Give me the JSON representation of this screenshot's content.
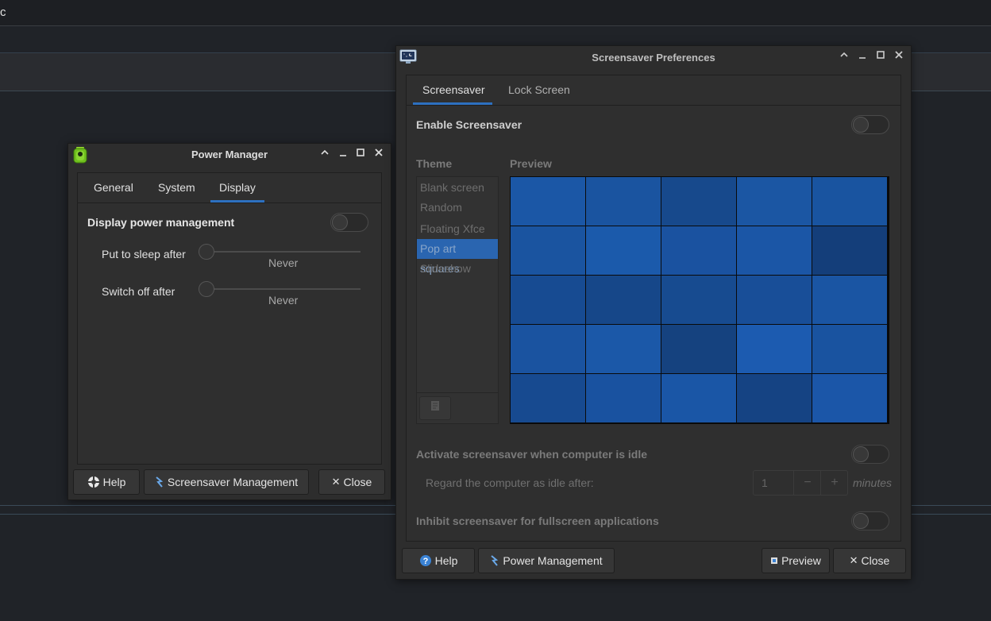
{
  "background": {
    "corner_letter": "c"
  },
  "power_manager": {
    "title": "Power Manager",
    "tabs": [
      {
        "label": "General"
      },
      {
        "label": "System"
      },
      {
        "label": "Display"
      }
    ],
    "display_power_management": {
      "label": "Display power management",
      "enabled": false
    },
    "sleep": {
      "label": "Put to sleep after",
      "value": "Never"
    },
    "switch_off": {
      "label": "Switch off after",
      "value": "Never"
    },
    "buttons": {
      "help": "Help",
      "screensaver_management": "Screensaver Management",
      "close": "Close"
    }
  },
  "screensaver": {
    "title": "Screensaver Preferences",
    "tabs": [
      {
        "label": "Screensaver"
      },
      {
        "label": "Lock Screen"
      }
    ],
    "enable": {
      "label": "Enable Screensaver",
      "enabled": false
    },
    "theme_header": "Theme",
    "preview_header": "Preview",
    "themes": [
      "Blank screen",
      "Random",
      "Floating Xfce",
      "Pop art squares",
      "Slideshow"
    ],
    "selected_theme": "Pop art squares",
    "preview_colors": [
      [
        "#1b57a6",
        "#1a54a0",
        "#17498c",
        "#1b56a3",
        "#1954a0"
      ],
      [
        "#1a54a0",
        "#1b5aab",
        "#1a52a0",
        "#1b56a6",
        "#143e7a"
      ],
      [
        "#174b92",
        "#164789",
        "#174b90",
        "#184e98",
        "#1a55a3"
      ],
      [
        "#1a53a0",
        "#1b58a8",
        "#15427f",
        "#1c5bb0",
        "#1953a0"
      ],
      [
        "#174a90",
        "#1952a0",
        "#1a56a6",
        "#154383",
        "#1b56a8"
      ]
    ],
    "activate_idle": {
      "label": "Activate screensaver when computer is idle",
      "enabled": false
    },
    "idle_after": {
      "label": "Regard the computer as idle after:",
      "value": "1",
      "unit": "minutes"
    },
    "inhibit": {
      "label": "Inhibit screensaver for fullscreen applications",
      "enabled": false
    },
    "buttons": {
      "help": "Help",
      "power_management": "Power Management",
      "preview": "Preview",
      "close": "Close"
    }
  }
}
